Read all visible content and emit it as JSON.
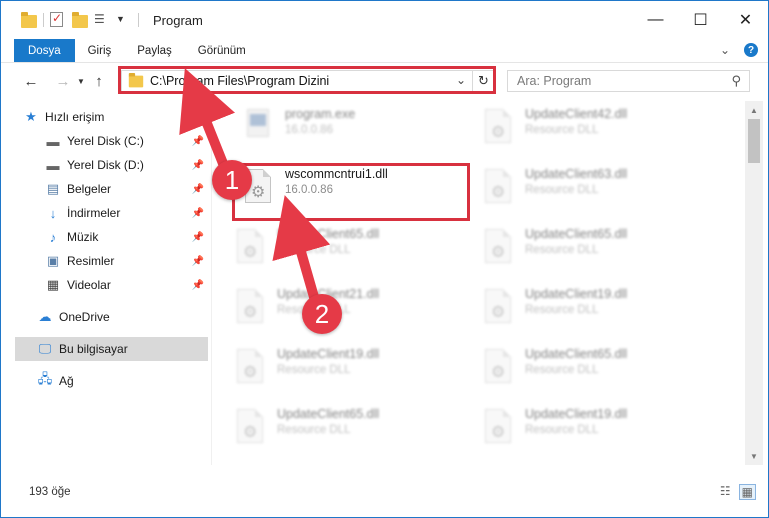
{
  "window": {
    "title": "Program"
  },
  "ribbon": {
    "tabs": [
      {
        "label": "Dosya"
      },
      {
        "label": "Giriş"
      },
      {
        "label": "Paylaş"
      },
      {
        "label": "Görünüm"
      }
    ]
  },
  "nav": {
    "address": "C:\\Program Files\\Program Dizini",
    "search_placeholder": "Ara: Program"
  },
  "sidebar": {
    "items": [
      {
        "label": "Hızlı erişim",
        "icon": "star-icon"
      },
      {
        "label": "Yerel Disk (C:)",
        "icon": "drive-icon"
      },
      {
        "label": "Yerel Disk (D:)",
        "icon": "drive-icon"
      },
      {
        "label": "Belgeler",
        "icon": "documents-icon"
      },
      {
        "label": "İndirmeler",
        "icon": "download-icon"
      },
      {
        "label": "Müzik",
        "icon": "music-icon"
      },
      {
        "label": "Resimler",
        "icon": "pictures-icon"
      },
      {
        "label": "Videolar",
        "icon": "videos-icon"
      },
      {
        "label": "OneDrive",
        "icon": "cloud-icon"
      },
      {
        "label": "Bu bilgisayar",
        "icon": "computer-icon"
      },
      {
        "label": "Ağ",
        "icon": "network-icon"
      }
    ]
  },
  "files": {
    "left": [
      {
        "name": "program.exe",
        "sub": "16.0.0.86"
      },
      {
        "name": "wscommcntrui1.dll",
        "sub": "16.0.0.86"
      },
      {
        "name": "UpdateClient65.dll",
        "sub": "Resource DLL"
      },
      {
        "name": "UpdateClient21.dll",
        "sub": "Resource DLL"
      },
      {
        "name": "UpdateClient19.dll",
        "sub": "Resource DLL"
      },
      {
        "name": "UpdateClient65.dll",
        "sub": "Resource DLL"
      }
    ],
    "right": [
      {
        "name": "UpdateClient42.dll",
        "sub": "Resource DLL"
      },
      {
        "name": "UpdateClient63.dll",
        "sub": "Resource DLL"
      },
      {
        "name": "UpdateClient65.dll",
        "sub": "Resource DLL"
      },
      {
        "name": "UpdateClient19.dll",
        "sub": "Resource DLL"
      },
      {
        "name": "UpdateClient65.dll",
        "sub": "Resource DLL"
      },
      {
        "name": "UpdateClient19.dll",
        "sub": "Resource DLL"
      }
    ]
  },
  "status": {
    "count": "193 öğe"
  },
  "annotations": {
    "badge1": "1",
    "badge2": "2",
    "color": "#e53a47"
  }
}
